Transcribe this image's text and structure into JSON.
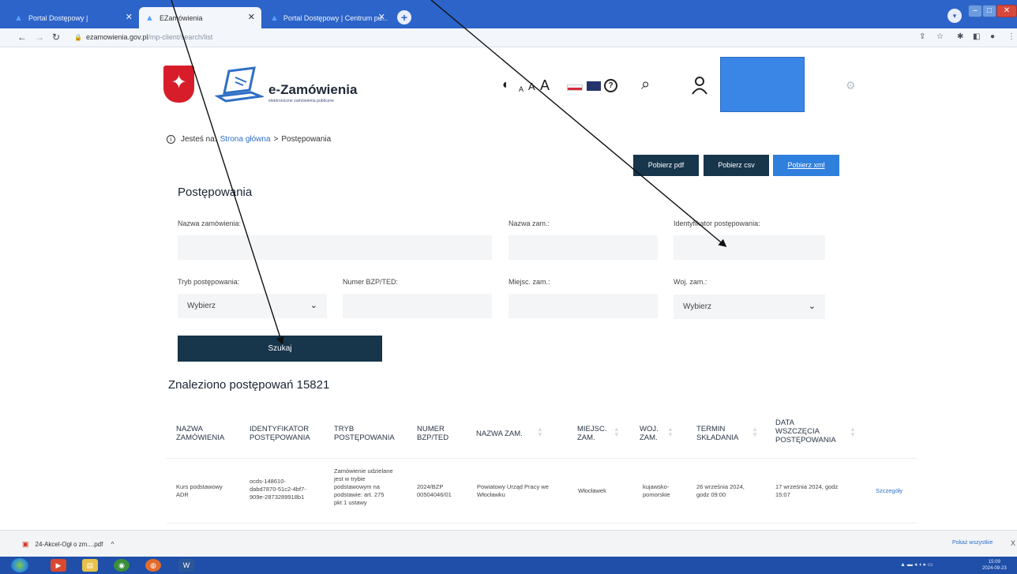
{
  "browser": {
    "tabs": [
      {
        "title": "Portal Dostępowy |",
        "active": false
      },
      {
        "title": "EZamówienia",
        "active": true
      },
      {
        "title": "Portal Dostępowy | Centrum pu...",
        "active": false
      }
    ],
    "new_tab_label": "+",
    "url_host": "ezamowienia.gov.pl",
    "url_path": "/mp-client/search/list"
  },
  "header": {
    "brand": "e-Zamówienia",
    "brand_subtitle": "elektroniczne zamówienia publiczne",
    "accessibility": {
      "a_small": "A",
      "a_medium": "A",
      "a_large": "A"
    }
  },
  "breadcrumb": {
    "prefix": "Jesteś na:",
    "home": "Strona główna",
    "separator": ">",
    "current": "Postępowania"
  },
  "export": {
    "pdf": "Pobierz pdf",
    "csv": "Pobierz csv",
    "xml": "Pobierz xml"
  },
  "page_title": "Postępowania",
  "filters": {
    "order_name_label": "Nazwa zamówienia:",
    "buyer_name_label": "Nazwa zam.:",
    "procedure_id_label": "Identyfikator postępowania:",
    "procedure_type_label": "Tryb postępowania:",
    "procedure_type_value": "Wybierz",
    "bzp_label": "Numer BZP/TED:",
    "city_label": "Miejsc. zam.:",
    "voivodeship_label": "Woj. zam.:",
    "voivodeship_value": "Wybierz",
    "search_button": "Szukaj"
  },
  "results": {
    "heading": "Znaleziono postępowań 15821",
    "columns": [
      [
        "NAZWA",
        "ZAMÓWIENIA"
      ],
      [
        "IDENTYFIKATOR",
        "POSTĘPOWANIA"
      ],
      [
        "TRYB",
        "POSTĘPOWANIA"
      ],
      [
        "NUMER",
        "BZP/TED"
      ],
      [
        "NAZWA ZAM."
      ],
      [
        "MIEJSC.",
        "ZAM."
      ],
      [
        "WOJ.",
        "ZAM."
      ],
      [
        "TERMIN",
        "SKŁADANIA"
      ],
      [
        "DATA",
        "WSZCZĘCIA",
        "POSTĘPOWANIA"
      ]
    ],
    "row": {
      "name": [
        "Kurs podstawowy",
        "ADR"
      ],
      "identifier": [
        "ocds-148610-",
        "dabd7870-51c2-4bf7-",
        "909e-2873289918b1"
      ],
      "procedure": [
        "Zamówienie udzielane",
        "jest w trybie",
        "podstawowym na",
        "podstawie: art. 275",
        "pkt 1 ustawy"
      ],
      "bzp": [
        "2024/BZP",
        "00504046/01"
      ],
      "buyer": [
        "Powiatowy Urząd Pracy we",
        "Włocławku"
      ],
      "city": [
        "Włocławek"
      ],
      "voivodeship": [
        "kujawsko-",
        "pomorskie"
      ],
      "deadline": [
        "26 września 2024,",
        "godz 09:00"
      ],
      "start": [
        "17 września 2024, godz",
        "15:07"
      ],
      "details": "Szczegóły"
    }
  },
  "downloads": {
    "file": "24-Akcel-Ogł o zm....pdf",
    "expand": "^",
    "show_all": "Pokaż wszystkie",
    "close": "X"
  },
  "taskbar": {
    "word_label": "W",
    "clock_time": "15:09",
    "clock_date": "2024-09-23"
  },
  "colors": {
    "dark_button": "#17354b",
    "accent_blue": "#2f7fdc",
    "link": "#2e6fc6",
    "tab_bar": "#2c64c9"
  }
}
